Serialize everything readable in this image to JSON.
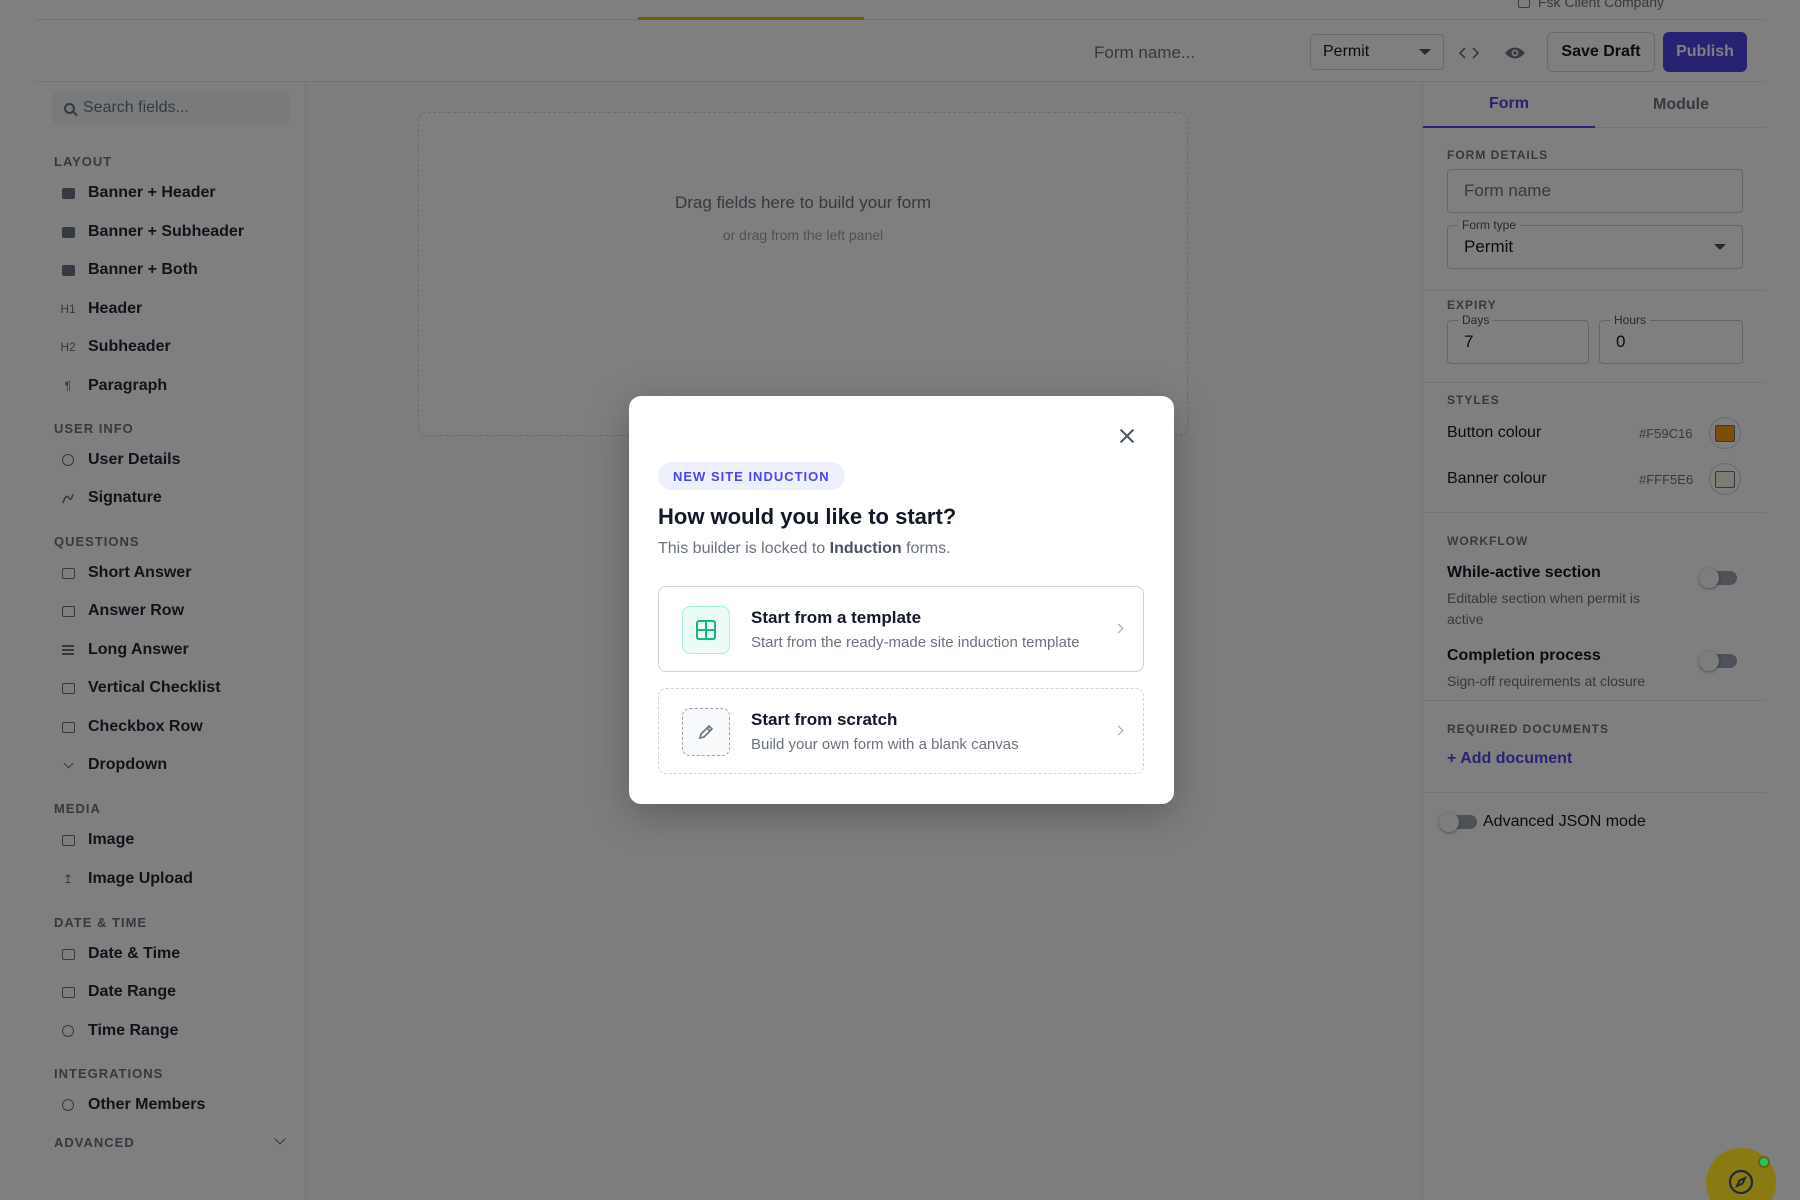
{
  "top_bar": {
    "client_name": "Fsk Client Company"
  },
  "toolbar": {
    "form_name_placeholder": "Form name...",
    "form_type_value": "Permit",
    "code_icon": "code-icon",
    "preview_icon": "eye-icon",
    "save_draft_label": "Save Draft",
    "publish_label": "Publish",
    "publish_color": "#4f46e5"
  },
  "sidebar": {
    "search_placeholder": "Search fields...",
    "sections": [
      {
        "title": "LAYOUT",
        "items": [
          {
            "label": "Banner + Header",
            "icon": "image-icon"
          },
          {
            "label": "Banner + Subheader",
            "icon": "image-icon"
          },
          {
            "label": "Banner + Both",
            "icon": "image-icon"
          },
          {
            "label": "Header",
            "icon": "h1-icon",
            "glyph": "H1"
          },
          {
            "label": "Subheader",
            "icon": "h2-icon",
            "glyph": "H2"
          },
          {
            "label": "Paragraph",
            "icon": "pilcrow-icon",
            "glyph": "¶"
          }
        ]
      },
      {
        "title": "USER INFO",
        "items": [
          {
            "label": "User Details",
            "icon": "person-icon"
          },
          {
            "label": "Signature",
            "icon": "signature-icon"
          }
        ]
      },
      {
        "title": "QUESTIONS",
        "items": [
          {
            "label": "Short Answer",
            "icon": "short-answer-icon"
          },
          {
            "label": "Answer Row",
            "icon": "answer-row-icon"
          },
          {
            "label": "Long Answer",
            "icon": "lines-icon"
          },
          {
            "label": "Vertical Checklist",
            "icon": "checklist-icon"
          },
          {
            "label": "Checkbox Row",
            "icon": "checkbox-icon"
          },
          {
            "label": "Dropdown",
            "icon": "chevron-down-icon"
          }
        ]
      },
      {
        "title": "MEDIA",
        "items": [
          {
            "label": "Image",
            "icon": "image-outline-icon"
          },
          {
            "label": "Image Upload",
            "icon": "upload-icon",
            "glyph": "↥"
          }
        ]
      },
      {
        "title": "DATE & TIME",
        "items": [
          {
            "label": "Date & Time",
            "icon": "calendar-icon"
          },
          {
            "label": "Date Range",
            "icon": "calendar-range-icon"
          },
          {
            "label": "Time Range",
            "icon": "clock-icon"
          }
        ]
      },
      {
        "title": "INTEGRATIONS",
        "items": [
          {
            "label": "Other Members",
            "icon": "members-icon"
          }
        ]
      }
    ],
    "advanced_title": "ADVANCED"
  },
  "canvas": {
    "drop_title": "Drag fields here to build your form",
    "drop_subtitle": "or drag from the left panel"
  },
  "right_panel": {
    "tabs": [
      "Form",
      "Module"
    ],
    "active_tab": "Form",
    "form_details_title": "FORM DETAILS",
    "form_name_placeholder": "Form name",
    "form_type_label": "Form type",
    "form_type_value": "Permit",
    "expiry_title": "EXPIRY",
    "days_label": "Days",
    "days_value": "7",
    "hours_label": "Hours",
    "hours_value": "0",
    "styles_title": "STYLES",
    "button_colour_label": "Button colour",
    "button_colour_hex": "#F59C16",
    "banner_colour_label": "Banner colour",
    "banner_colour_hex": "#FFF5E6",
    "workflow_title": "WORKFLOW",
    "while_active_title": "While-active section",
    "while_active_desc": "Editable section when permit is active",
    "completion_title": "Completion process",
    "completion_desc": "Sign-off requirements at closure",
    "required_docs_title": "REQUIRED DOCUMENTS",
    "add_document_label": "+ Add document",
    "json_mode_label": "Advanced JSON mode"
  },
  "modal": {
    "badge": "NEW SITE INDUCTION",
    "title": "How would you like to start?",
    "subtitle_prefix": "This builder is locked to ",
    "subtitle_bold": "Induction",
    "subtitle_suffix": " forms.",
    "options": [
      {
        "title": "Start from a template",
        "description": "Start from the ready-made site induction template",
        "icon": "template-grid-icon",
        "accent": "#10b981"
      },
      {
        "title": "Start from scratch",
        "description": "Build your own form with a blank canvas",
        "icon": "pencil-icon"
      }
    ]
  },
  "assistant": {
    "icon": "compass-icon",
    "status_color": "#22c55e"
  }
}
